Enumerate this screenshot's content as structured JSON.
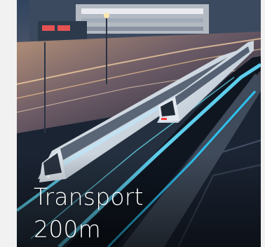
{
  "tile": {
    "title": "Transport",
    "distance": "200m",
    "image_subject": "train-image"
  },
  "colors": {
    "background": "#f1f1f1",
    "caption_text": "#ffffff",
    "accent_glow": "#27d6ff"
  }
}
